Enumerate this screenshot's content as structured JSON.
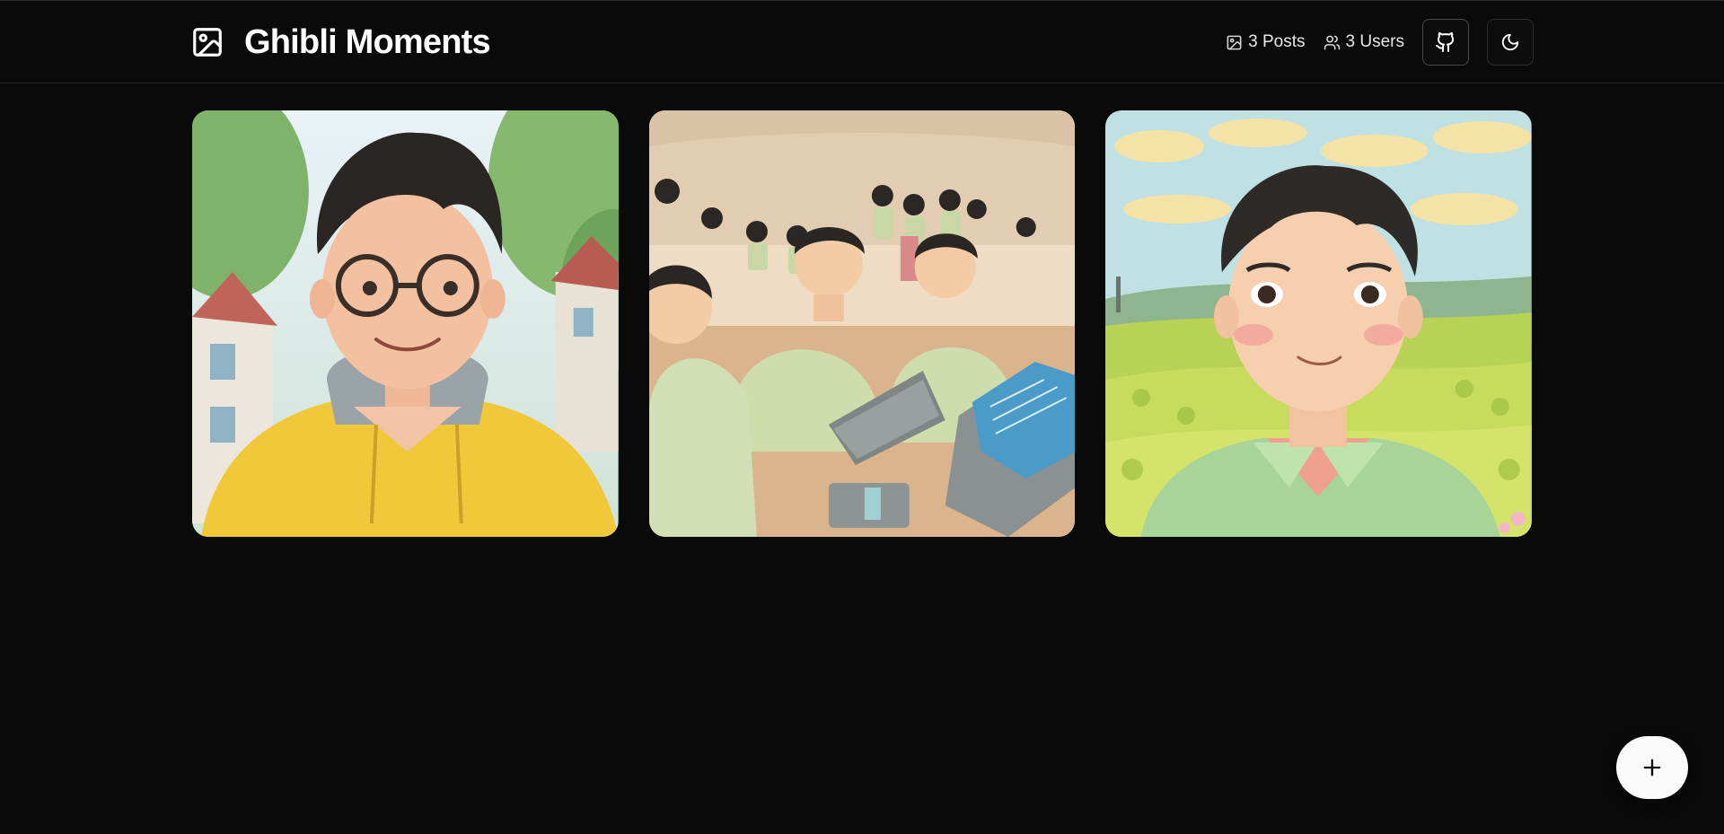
{
  "header": {
    "title": "Ghibli Moments",
    "logo_icon": "image-icon",
    "stats": {
      "posts_label": "3 Posts",
      "users_label": "3 Users"
    },
    "github_icon": "github-icon",
    "theme_icon": "moon-icon"
  },
  "gallery": {
    "posts": [
      {
        "subject": "boy-with-glasses-yellow-hoodie"
      },
      {
        "subject": "classroom-students-laptops"
      },
      {
        "subject": "boy-green-shirt-hills"
      }
    ]
  },
  "fab": {
    "icon": "plus-icon"
  },
  "colors": {
    "background": "#0a0a0a",
    "text": "#ffffff",
    "border": "#262626",
    "fab": "#fafafa"
  }
}
